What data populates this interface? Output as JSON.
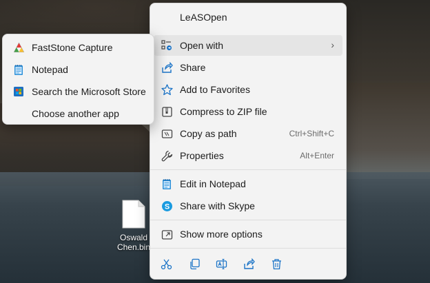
{
  "desktop": {
    "file": {
      "name_line1": "Oswald",
      "name_line2": "Chen.bin",
      "icon": "blank-file-icon"
    }
  },
  "context_menu": {
    "title": "LeASOpen",
    "items": [
      {
        "label": "Open with",
        "icon": "open-with-icon",
        "has_submenu": true,
        "submenu_arrow": "›"
      },
      {
        "label": "Share",
        "icon": "share-icon"
      },
      {
        "label": "Add to Favorites",
        "icon": "star-icon"
      },
      {
        "label": "Compress to ZIP file",
        "icon": "zip-icon"
      },
      {
        "label": "Copy as path",
        "icon": "copy-path-icon",
        "shortcut": "Ctrl+Shift+C"
      },
      {
        "label": "Properties",
        "icon": "wrench-icon",
        "shortcut": "Alt+Enter"
      },
      {
        "label": "Edit in Notepad",
        "icon": "notepad-icon"
      },
      {
        "label": "Share with Skype",
        "icon": "skype-icon"
      },
      {
        "label": "Show more options",
        "icon": "show-more-icon"
      }
    ],
    "toolbar": [
      {
        "action": "cut",
        "icon": "scissors-icon"
      },
      {
        "action": "copy",
        "icon": "copy-icon"
      },
      {
        "action": "rename",
        "icon": "rename-icon"
      },
      {
        "action": "share",
        "icon": "share-icon"
      },
      {
        "action": "delete",
        "icon": "trash-icon"
      }
    ]
  },
  "open_with_submenu": {
    "items": [
      {
        "label": "FastStone Capture",
        "icon": "faststone-capture-icon"
      },
      {
        "label": "Notepad",
        "icon": "notepad-icon"
      },
      {
        "label": "Search the Microsoft Store",
        "icon": "microsoft-store-icon"
      },
      {
        "label": "Choose another app",
        "icon": ""
      }
    ]
  },
  "colors": {
    "accent": "#1a73c7",
    "menu_bg": "#f3f3f3",
    "highlight": "#e5e5e5"
  }
}
